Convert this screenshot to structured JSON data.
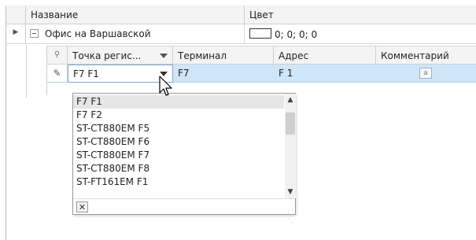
{
  "columns": {
    "name": "Название",
    "color": "Цвет"
  },
  "group_row": {
    "expand_icon": "collapse-minus-icon",
    "name": "Офис на Варшавской",
    "color_value": "0; 0; 0; 0"
  },
  "detail": {
    "headers": [
      "Точка регис...",
      "Терминал",
      "Адрес",
      "Комментарий"
    ],
    "row": {
      "point": "F7 F1",
      "terminal": "F7",
      "address": "F 1",
      "comment_icon": "memo-icon"
    }
  },
  "dropdown": {
    "options": [
      "F7 F1",
      "F7 F2",
      "ST-CT880EM F5",
      "ST-CT880EM F6",
      "ST-CT880EM F7",
      "ST-CT880EM F8",
      "ST-FT161EM F1"
    ],
    "selected_index": 0,
    "clear_label": "✕"
  }
}
